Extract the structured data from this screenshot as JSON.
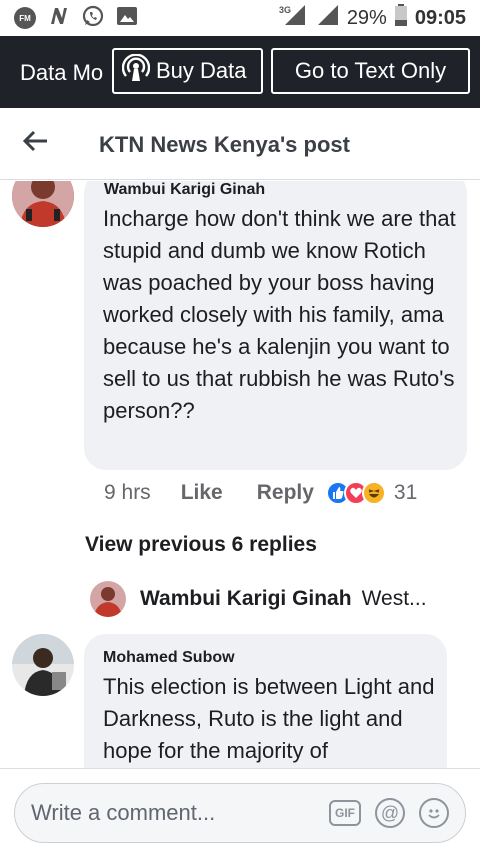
{
  "status_bar": {
    "network_type": "3G",
    "battery_percent": "29%",
    "time": "09:05",
    "left_icons": [
      "fm-radio-icon",
      "n-app-icon",
      "whatsapp-icon",
      "gallery-icon"
    ]
  },
  "data_banner": {
    "mode_label": "Data Mo",
    "buy_data_label": "Buy Data",
    "text_only_label": "Go to Text Only"
  },
  "header": {
    "title": "KTN News Kenya's post"
  },
  "comments": [
    {
      "author": "Wambui Karigi Ginah",
      "text": "Incharge how don't think we are that stupid and dumb we know Rotich was poached by your boss having worked closely with his family, ama because he's a kalenjin you want to sell to us that rubbish he was Ruto's person??",
      "time": "9 hrs",
      "like_label": "Like",
      "reply_label": "Reply",
      "reaction_count": "31",
      "reactions": [
        "like",
        "love",
        "haha"
      ]
    },
    {
      "author": "Mohamed Subow",
      "text": "This election is between Light and Darkness, Ruto is the light and hope for the majority of"
    }
  ],
  "replies": {
    "view_previous_label": "View previous 6 replies",
    "latest_reply_author": "Wambui Karigi Ginah",
    "latest_reply_preview": "West..."
  },
  "composer": {
    "placeholder": "Write a comment..."
  },
  "colors": {
    "banner_bg": "#1f2229",
    "bubble_bg": "#f0f1f4",
    "like_blue": "#1877f2",
    "love_red": "#f33e58",
    "haha_yellow": "#f7b125"
  }
}
